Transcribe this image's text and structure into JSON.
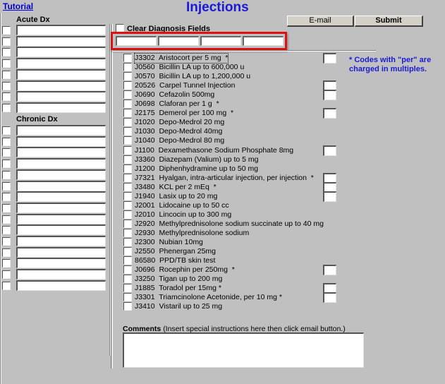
{
  "page": {
    "title": "Injections",
    "tutorial_link": "Tutorial"
  },
  "toolbar": {
    "email_label": "E-mail",
    "submit_label": "Submit"
  },
  "left_panel": {
    "acute_label": "Acute Dx",
    "acute_rows": 8,
    "chronic_label": "Chronic Dx",
    "chronic_rows": 15
  },
  "clear_fields": {
    "label": "Clear Diagnosis Fields",
    "checked": false,
    "code_fields": [
      "",
      "",
      "",
      ""
    ]
  },
  "note": "*  Codes with \"per\" are charged in multiples.",
  "injections": [
    {
      "code": "J3302",
      "name": "Aristocort per 5 mg  *",
      "qty": true,
      "focused": true
    },
    {
      "code": "J0560",
      "name": "Bicillin LA up to 600,000 u",
      "qty": false
    },
    {
      "code": "J0570",
      "name": "Bicillin LA up to 1,200,000 u",
      "qty": false
    },
    {
      "code": "20526",
      "name": "Carpel Tunnel Injection",
      "qty": true
    },
    {
      "code": "J0690",
      "name": "Cefazolin 500mg",
      "qty": true
    },
    {
      "code": "J0698",
      "name": "Claforan per 1 g  *",
      "qty": false
    },
    {
      "code": "J2175",
      "name": "Demerol per 100 mg  *",
      "qty": true
    },
    {
      "code": "J1020",
      "name": "Depo-Medrol 20 mg",
      "qty": false
    },
    {
      "code": "J1030",
      "name": "Depo-Medrol 40mg",
      "qty": false
    },
    {
      "code": "J1040",
      "name": "Depo-Medrol 80 mg",
      "qty": false
    },
    {
      "code": "J1100",
      "name": "Dexamethasone Sodium Phosphate 8mg",
      "qty": true
    },
    {
      "code": "J3360",
      "name": "Diazepam (Valium) up to 5 mg",
      "qty": false
    },
    {
      "code": "J1200",
      "name": "Diphenhydramine up to 50 mg",
      "qty": false
    },
    {
      "code": "J7321",
      "name": "Hyalgan, intra-articular injection, per injection  *",
      "qty": true
    },
    {
      "code": "J3480",
      "name": "KCL per 2 mEq  *",
      "qty": true
    },
    {
      "code": "J1940",
      "name": "Lasix up to 20 mg",
      "qty": true
    },
    {
      "code": "J2001",
      "name": "Lidocaine up to 50 cc",
      "qty": false
    },
    {
      "code": "J2010",
      "name": "Lincocin up to 300 mg",
      "qty": false
    },
    {
      "code": "J2920",
      "name": "Methylprednisolone sodium succinate up to 40 mg",
      "qty": false
    },
    {
      "code": "J2930",
      "name": "Methylprednisolone sodium",
      "qty": false
    },
    {
      "code": "J2300",
      "name": "Nubian 10mg",
      "qty": false
    },
    {
      "code": "J2550",
      "name": "Phenergan 25mg",
      "qty": false
    },
    {
      "code": "86580",
      "name": "PPD/TB skin test",
      "qty": false
    },
    {
      "code": "J0696",
      "name": "Rocephin per 250mg  *",
      "qty": true
    },
    {
      "code": "J3250",
      "name": "Tigan up to 200 mg",
      "qty": false
    },
    {
      "code": "J1885",
      "name": "Toradol per 15mg *",
      "qty": true
    },
    {
      "code": "J3301",
      "name": "Triamcinolone Acetonide, per 10 mg *",
      "qty": true
    },
    {
      "code": "J3410",
      "name": "Vistaril up to 25 mg",
      "qty": false
    }
  ],
  "comments": {
    "label": "Comments",
    "hint": "(Insert special instructions here then click email button.)",
    "value": ""
  }
}
